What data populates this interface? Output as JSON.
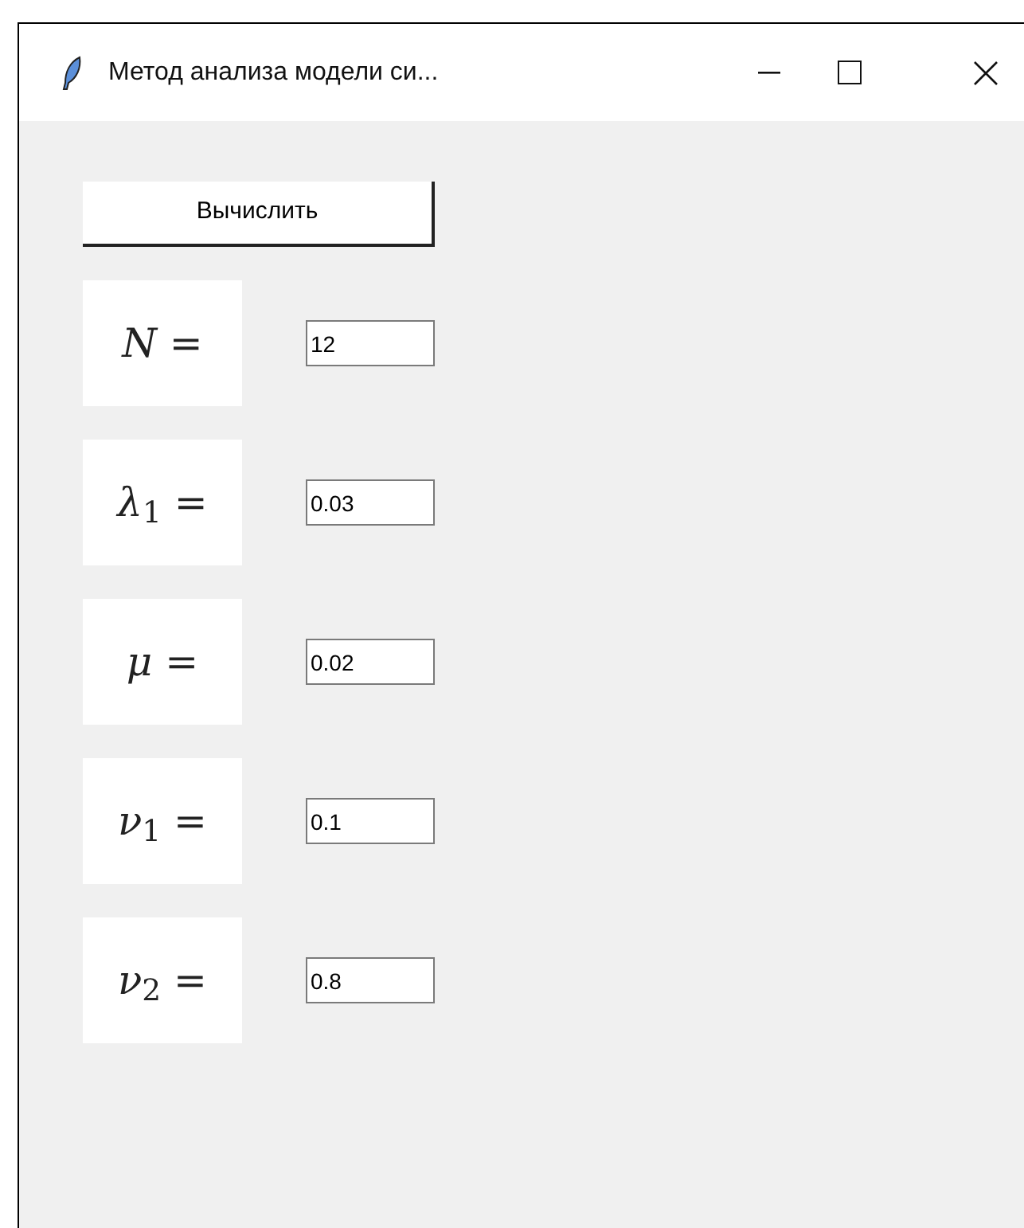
{
  "window": {
    "title": "Метод анализа модели си..."
  },
  "button": {
    "label": "Вычислить"
  },
  "params": [
    {
      "label": "*N* =",
      "value": "12"
    },
    {
      "label": "*λ*$_{1}$ =",
      "value": "0.03"
    },
    {
      "label": "*μ* =",
      "value": "0.02"
    },
    {
      "label": "*ν*$_{1}$ =",
      "value": "0.1"
    },
    {
      "label": "*ν*$_{2}$ =",
      "value": "0.8"
    }
  ]
}
